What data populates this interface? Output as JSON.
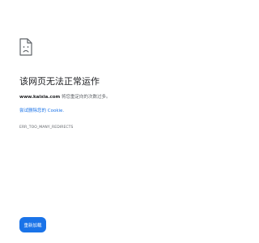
{
  "error": {
    "icon": "sad-page-icon",
    "title": "该网页无法正常运作",
    "domain": "www.kaixia.com",
    "message": " 将您重定向的次数过多。",
    "cookie_link": "尝试删除您的 Cookie.",
    "code": "ERR_TOO_MANY_REDIRECTS"
  },
  "actions": {
    "reload_label": "重新加载"
  },
  "colors": {
    "accent": "#1a73e8",
    "title_text": "#202124",
    "secondary_text": "#5f6368"
  }
}
